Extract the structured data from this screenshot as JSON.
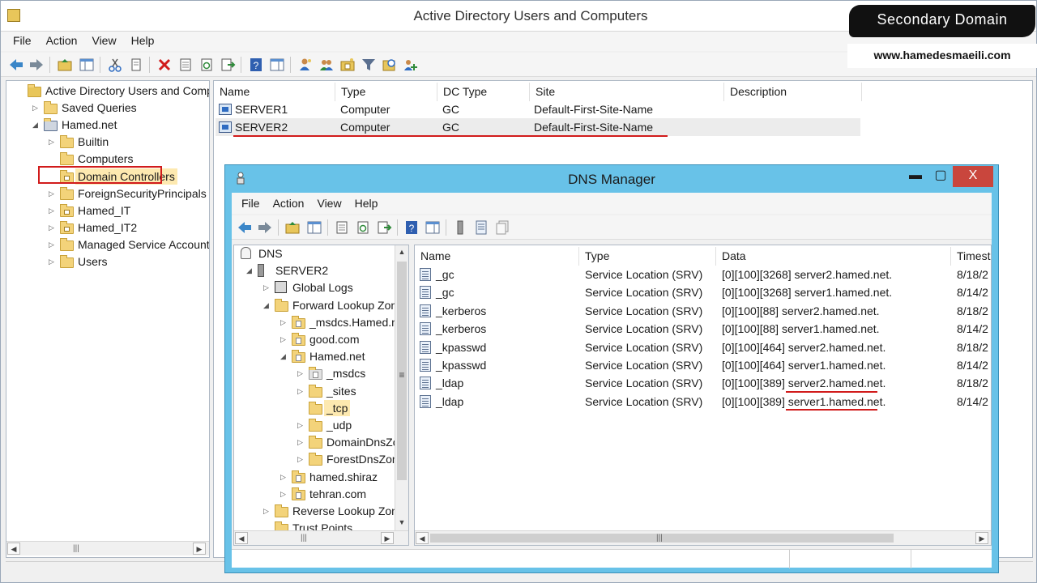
{
  "aduc": {
    "title": "Active Directory Users and Computers",
    "menu": [
      "File",
      "Action",
      "View",
      "Help"
    ],
    "tree": [
      {
        "label": "Active Directory Users and Computer",
        "level": 0,
        "expander": "",
        "icon": "aduc"
      },
      {
        "label": "Saved Queries",
        "level": 1,
        "expander": "collapsed",
        "icon": "folder"
      },
      {
        "label": "Hamed.net",
        "level": 1,
        "expander": "expanded",
        "icon": "domain"
      },
      {
        "label": "Builtin",
        "level": 2,
        "expander": "collapsed",
        "icon": "folder"
      },
      {
        "label": "Computers",
        "level": 2,
        "expander": "",
        "icon": "folder"
      },
      {
        "label": "Domain Controllers",
        "level": 2,
        "expander": "",
        "icon": "ou",
        "selected": true
      },
      {
        "label": "ForeignSecurityPrincipals",
        "level": 2,
        "expander": "collapsed",
        "icon": "folder"
      },
      {
        "label": "Hamed_IT",
        "level": 2,
        "expander": "collapsed",
        "icon": "ou"
      },
      {
        "label": "Hamed_IT2",
        "level": 2,
        "expander": "collapsed",
        "icon": "ou"
      },
      {
        "label": "Managed Service Accounts",
        "level": 2,
        "expander": "collapsed",
        "icon": "folder"
      },
      {
        "label": "Users",
        "level": 2,
        "expander": "collapsed",
        "icon": "folder"
      }
    ],
    "columns": [
      "Name",
      "Type",
      "DC Type",
      "Site",
      "Description"
    ],
    "rows": [
      {
        "name": "SERVER1",
        "type": "Computer",
        "dc_type": "GC",
        "site": "Default-First-Site-Name",
        "description": ""
      },
      {
        "name": "SERVER2",
        "type": "Computer",
        "dc_type": "GC",
        "site": "Default-First-Site-Name",
        "description": ""
      }
    ]
  },
  "badge": {
    "title": "Secondary Domain",
    "site": "www.hamedesmaeili.com"
  },
  "dns": {
    "title": "DNS Manager",
    "menu": [
      "File",
      "Action",
      "View",
      "Help"
    ],
    "window_buttons": {
      "minimize": "▬",
      "maximize": "▢",
      "close": "X"
    },
    "tree": [
      {
        "label": "DNS",
        "level": 0,
        "expander": "",
        "icon": "dns"
      },
      {
        "label": "SERVER2",
        "level": 1,
        "expander": "expanded",
        "icon": "server"
      },
      {
        "label": "Global Logs",
        "level": 2,
        "expander": "collapsed",
        "icon": "logs"
      },
      {
        "label": "Forward Lookup Zones",
        "level": 2,
        "expander": "expanded",
        "icon": "folder"
      },
      {
        "label": "_msdcs.Hamed.net",
        "level": 3,
        "expander": "collapsed",
        "icon": "zone"
      },
      {
        "label": "good.com",
        "level": 3,
        "expander": "collapsed",
        "icon": "zone"
      },
      {
        "label": "Hamed.net",
        "level": 3,
        "expander": "expanded",
        "icon": "zone"
      },
      {
        "label": "_msdcs",
        "level": 4,
        "expander": "collapsed",
        "icon": "zone-gray"
      },
      {
        "label": "_sites",
        "level": 4,
        "expander": "collapsed",
        "icon": "folder"
      },
      {
        "label": "_tcp",
        "level": 4,
        "expander": "",
        "icon": "folder",
        "selected": true
      },
      {
        "label": "_udp",
        "level": 4,
        "expander": "collapsed",
        "icon": "folder"
      },
      {
        "label": "DomainDnsZones",
        "level": 4,
        "expander": "collapsed",
        "icon": "folder"
      },
      {
        "label": "ForestDnsZones",
        "level": 4,
        "expander": "collapsed",
        "icon": "folder"
      },
      {
        "label": "hamed.shiraz",
        "level": 3,
        "expander": "collapsed",
        "icon": "zone"
      },
      {
        "label": "tehran.com",
        "level": 3,
        "expander": "collapsed",
        "icon": "zone"
      },
      {
        "label": "Reverse Lookup Zones",
        "level": 2,
        "expander": "collapsed",
        "icon": "folder"
      },
      {
        "label": "Trust Points",
        "level": 2,
        "expander": "",
        "icon": "folder"
      }
    ],
    "columns": [
      "Name",
      "Type",
      "Data",
      "Timest"
    ],
    "records": [
      {
        "name": "_gc",
        "type": "Service Location (SRV)",
        "data": "[0][100][3268] server2.hamed.net.",
        "timestamp": "8/18/2"
      },
      {
        "name": "_gc",
        "type": "Service Location (SRV)",
        "data": "[0][100][3268] server1.hamed.net.",
        "timestamp": "8/14/2"
      },
      {
        "name": "_kerberos",
        "type": "Service Location (SRV)",
        "data": "[0][100][88] server2.hamed.net.",
        "timestamp": "8/18/2"
      },
      {
        "name": "_kerberos",
        "type": "Service Location (SRV)",
        "data": "[0][100][88] server1.hamed.net.",
        "timestamp": "8/14/2"
      },
      {
        "name": "_kpasswd",
        "type": "Service Location (SRV)",
        "data": "[0][100][464] server2.hamed.net.",
        "timestamp": "8/18/2"
      },
      {
        "name": "_kpasswd",
        "type": "Service Location (SRV)",
        "data": "[0][100][464] server1.hamed.net.",
        "timestamp": "8/14/2"
      },
      {
        "name": "_ldap",
        "type": "Service Location (SRV)",
        "data": "[0][100][389] server2.hamed.net.",
        "timestamp": "8/18/2"
      },
      {
        "name": "_ldap",
        "type": "Service Location (SRV)",
        "data": "[0][100][389] server1.hamed.net.",
        "timestamp": "8/14/2"
      }
    ]
  },
  "colors": {
    "highlight_red": "#d11b1b",
    "dns_frame": "#68c2e8",
    "close_button": "#c9463d"
  }
}
